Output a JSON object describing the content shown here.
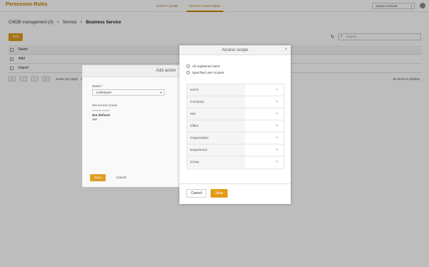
{
  "app": {
    "title": "Permission Rules",
    "tabs": [
      {
        "label": "ENTITY NAME"
      },
      {
        "label": "ENTITY FUNCTIONS"
      }
    ],
    "system_select": "System Default",
    "chevron": "▾"
  },
  "breadcrumb": {
    "items": [
      "CMDB management (0)",
      "Service",
      "Business Service"
    ],
    "separator": ">"
  },
  "toolbar": {
    "add_label": "Add",
    "search_placeholder": "Search..."
  },
  "table": {
    "header": "Name",
    "rows": [
      "Add",
      "Import"
    ]
  },
  "pager": {
    "first": "«",
    "prev": "‹",
    "next": "›",
    "last": "»",
    "rows_label": "Rows per page:",
    "rows_count": "2",
    "no_items": "No items to display"
  },
  "add_action": {
    "title": "Add action",
    "name_label": "Name *",
    "name_value": "List/Import",
    "scope_label": "Set access scope",
    "scope_hint": "Access scope",
    "scope_value": "Not defined",
    "scope_extra": "Set",
    "save_label": "Save",
    "cancel_label": "Cancel"
  },
  "access_scope": {
    "title": "Access scope",
    "close": "×",
    "options": [
      "All registered users",
      "Specified user scopes"
    ],
    "rows": [
      "Users",
      "Company",
      "Site",
      "Office",
      "Organization",
      "Department",
      "Group"
    ],
    "edit_glyph": "✎",
    "cancel_label": "Cancel",
    "save_label": "Save"
  },
  "colors": {
    "accent": "#e39b17",
    "brand": "#c78300"
  }
}
